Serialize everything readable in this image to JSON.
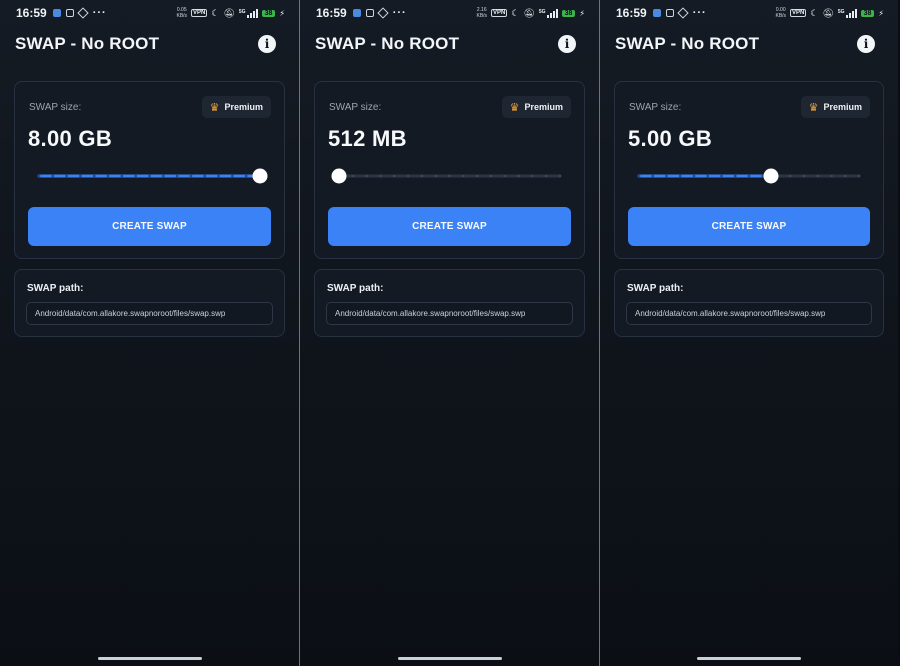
{
  "phones": [
    {
      "status": {
        "time": "16:59",
        "speed_top": "0.05",
        "speed_unit": "KB/s",
        "vpn": "VPN",
        "network": "5G",
        "battery": "38"
      },
      "app_title": "SWAP - No ROOT",
      "size_label": "SWAP size:",
      "premium_label": "Premium",
      "size_value": "8.00 GB",
      "slider": {
        "fraction": 1.0,
        "steps": 16
      },
      "create_label": "CREATE SWAP",
      "path_label": "SWAP path:",
      "path_value": "Android/data/com.allakore.swapnoroot/files/swap.swp"
    },
    {
      "status": {
        "time": "16:59",
        "speed_top": "2.16",
        "speed_unit": "KB/s",
        "vpn": "VPN",
        "network": "5G",
        "battery": "38"
      },
      "app_title": "SWAP - No ROOT",
      "size_label": "SWAP size:",
      "premium_label": "Premium",
      "size_value": "512 MB",
      "slider": {
        "fraction": 0.0,
        "steps": 16
      },
      "create_label": "CREATE SWAP",
      "path_label": "SWAP path:",
      "path_value": "Android/data/com.allakore.swapnoroot/files/swap.swp"
    },
    {
      "status": {
        "time": "16:59",
        "speed_top": "0.00",
        "speed_unit": "KB/s",
        "vpn": "VPN",
        "network": "5G",
        "battery": "38"
      },
      "app_title": "SWAP - No ROOT",
      "size_label": "SWAP size:",
      "premium_label": "Premium",
      "size_value": "5.00 GB",
      "slider": {
        "fraction": 0.6,
        "steps": 16
      },
      "create_label": "CREATE SWAP",
      "path_label": "SWAP path:",
      "path_value": "Android/data/com.allakore.swapnoroot/files/swap.swp"
    }
  ],
  "colors": {
    "accent": "#3b82f6",
    "track_inactive": "#2b3544",
    "thumb": "#ffffff",
    "crown": "#f1a43a",
    "battery": "#3bb54a"
  },
  "icons": {
    "info": "info-icon",
    "crown": "crown-icon"
  }
}
